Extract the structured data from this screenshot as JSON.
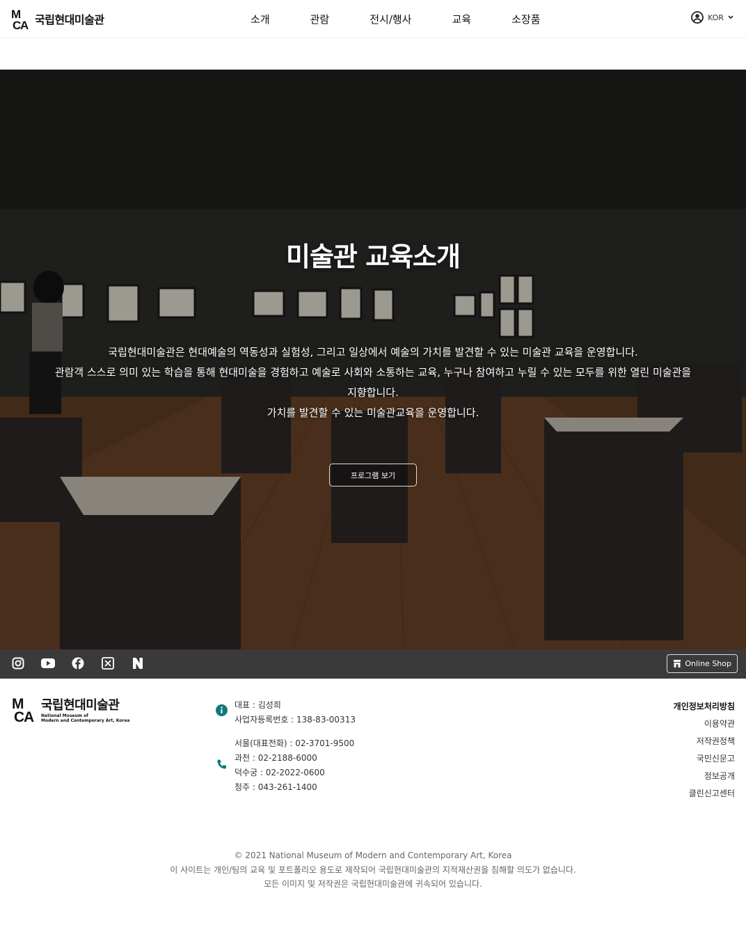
{
  "header": {
    "logo_text": "국립현대미술관",
    "nav": [
      "소개",
      "관람",
      "전시/행사",
      "교육",
      "소장품"
    ],
    "lang_label": "KOR"
  },
  "hero": {
    "title": "미술관 교육소개",
    "desc_lines": [
      "국립현대미술관은 현대예술의 역동성과 실험성, 그리고 일상에서 예술의 가치를 발견할 수 있는 미술관 교육을 운영합니다.",
      "관람객 스스로 의미 있는 학습을 통해 현대미술을 경험하고 예술로 사회와 소통하는 교육, 누구나 참여하고 누릴 수 있는 모두를 위한 열린 미술관을",
      "지향합니다.",
      "가치를 발견할 수 있는 미술관교육을 운영합니다."
    ],
    "button_label": "프로그램 보기"
  },
  "social": {
    "icons": [
      "instagram-icon",
      "youtube-icon",
      "facebook-icon",
      "x-icon",
      "naver-icon"
    ],
    "shop_label": "Online Shop"
  },
  "footer": {
    "logo_title": "국립현대미술관",
    "logo_sub_1": "National Museum of",
    "logo_sub_2": "Modern and Contemporary Art, Korea",
    "ceo": "대표 : 김성희",
    "biz_no": "사업자등록번호 : 138-83-00313",
    "phones": [
      "서울(대표전화) : 02-3701-9500",
      "과천 : 02-2188-6000",
      "덕수궁 : 02-2022-0600",
      "청주 : 043-261-1400"
    ],
    "links": [
      "개인정보처리방침",
      "이용약관",
      "저작권정책",
      "국민신문고",
      "정보공개",
      "클린신고센터"
    ],
    "copyright": [
      "© 2021 National Museum of Modern and Contemporary Art, Korea",
      "이 사이트는 개인/팀의 교육 및 포트폴리오 용도로 제작되어 국립현대미술관의 지적재산권을 침해할 의도가 없습니다.",
      "모든 이미지 및 저작권은 국립현대미술관에 귀속되어 있습니다."
    ],
    "accent_color": "#0f7a7a"
  }
}
